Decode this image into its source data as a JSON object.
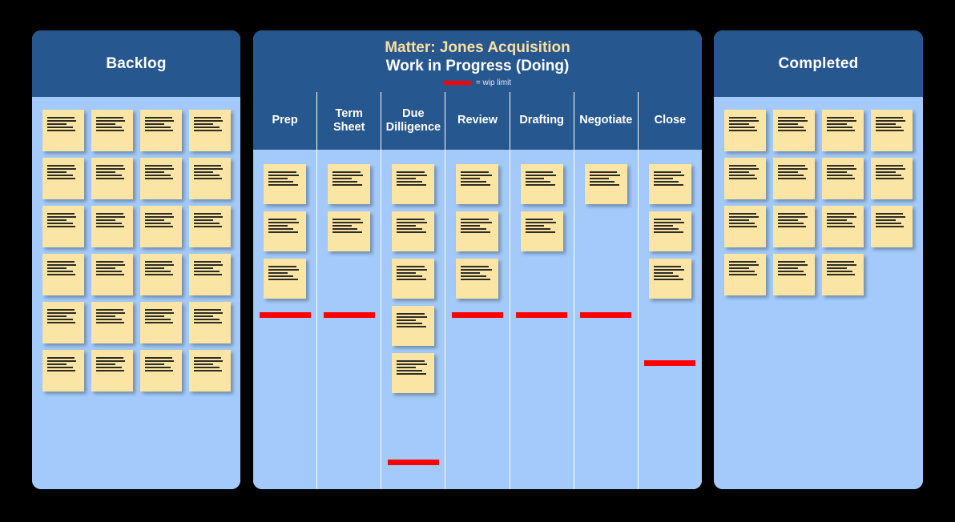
{
  "backlog": {
    "title": "Backlog",
    "card_count": 24,
    "columns_per_row": 4,
    "rows": 6
  },
  "wip": {
    "matter_title": "Matter: Jones Acquisition",
    "board_title": "Work in Progress (Doing)",
    "legend_label": "= wip limit",
    "legend_bar_color": "#FF0000",
    "columns": [
      {
        "label": "Prep",
        "card_count": 3,
        "wip_limit_offset": 203
      },
      {
        "label": "Term Sheet",
        "card_count": 2,
        "wip_limit_offset": 203
      },
      {
        "label": "Due Dilligence",
        "card_count": 5,
        "wip_limit_offset": 387
      },
      {
        "label": "Review",
        "card_count": 3,
        "wip_limit_offset": 203
      },
      {
        "label": "Drafting",
        "card_count": 2,
        "wip_limit_offset": 203
      },
      {
        "label": "Negotiate",
        "card_count": 1,
        "wip_limit_offset": 203
      },
      {
        "label": "Close",
        "card_count": 3,
        "wip_limit_offset": 263
      }
    ]
  },
  "completed": {
    "title": "Completed",
    "card_count": 15,
    "columns_per_row": 4,
    "rows": 4
  },
  "theme": {
    "header_blue": "#27578F",
    "body_blue": "#A3CAFA",
    "note_cream": "#FAE5A4",
    "accent_cream": "#FADFA0",
    "wip_red": "#FF0000",
    "page_background": "#000000"
  }
}
